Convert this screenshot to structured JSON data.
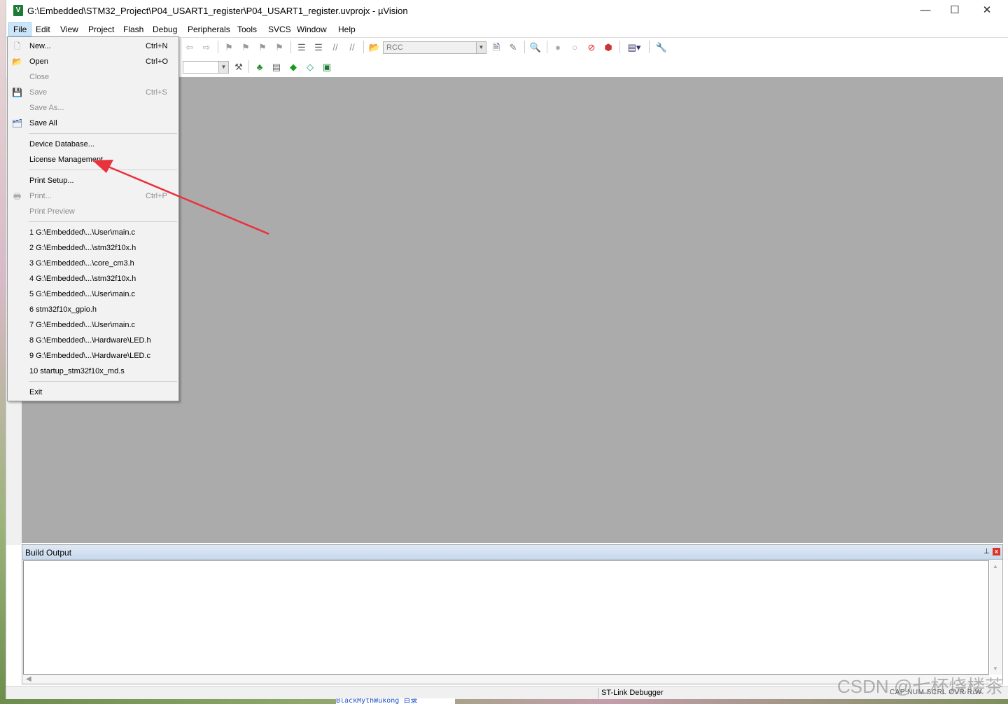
{
  "window": {
    "title": "G:\\Embedded\\STM32_Project\\P04_USART1_register\\P04_USART1_register.uvprojx - µVision",
    "app_icon": "uv",
    "controls": {
      "minimize": "—",
      "maximize": "☐",
      "close": "✕"
    }
  },
  "menubar": {
    "items": [
      "File",
      "Edit",
      "View",
      "Project",
      "Flash",
      "Debug",
      "Peripherals",
      "Tools",
      "SVCS",
      "Window",
      "Help"
    ],
    "active": "File"
  },
  "toolbar": {
    "find_combo_value": "RCC"
  },
  "file_menu": {
    "new": {
      "label": "New...",
      "shortcut": "Ctrl+N"
    },
    "open": {
      "label": "Open",
      "shortcut": "Ctrl+O"
    },
    "close": {
      "label": "Close"
    },
    "save": {
      "label": "Save",
      "shortcut": "Ctrl+S"
    },
    "save_as": {
      "label": "Save As..."
    },
    "save_all": {
      "label": "Save All"
    },
    "device_database": {
      "label": "Device Database..."
    },
    "license_management": {
      "label": "License Management..."
    },
    "print_setup": {
      "label": "Print Setup..."
    },
    "print": {
      "label": "Print...",
      "shortcut": "Ctrl+P"
    },
    "print_preview": {
      "label": "Print Preview"
    },
    "recent": [
      "1 G:\\Embedded\\...\\User\\main.c",
      "2 G:\\Embedded\\...\\stm32f10x.h",
      "3 G:\\Embedded\\...\\core_cm3.h",
      "4 G:\\Embedded\\...\\stm32f10x.h",
      "5 G:\\Embedded\\...\\User\\main.c",
      "6 stm32f10x_gpio.h",
      "7 G:\\Embedded\\...\\User\\main.c",
      "8 G:\\Embedded\\...\\Hardware\\LED.h",
      "9 G:\\Embedded\\...\\Hardware\\LED.c",
      "10 startup_stm32f10x_md.s"
    ],
    "exit": {
      "label": "Exit"
    }
  },
  "build_output": {
    "title": "Build Output",
    "pin": "📌",
    "close": "x"
  },
  "statusbar": {
    "debugger": "ST-Link Debugger",
    "keys": "CAP  NUM  SCRL  OVR  R/W"
  },
  "taskbar_snippet": "BlackMythWukong  目录",
  "watermark": "CSDN @七杯烧楼茶",
  "colors": {
    "annotation_arrow": "#e8323c",
    "editor_bg": "#ababab",
    "menu_bg": "#f2f2f2",
    "active_menu": "#cce4f7"
  }
}
